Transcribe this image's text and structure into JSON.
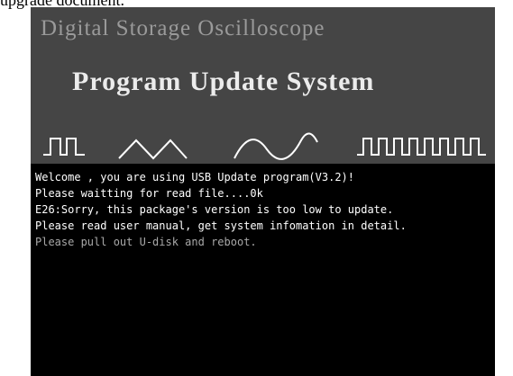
{
  "caption": "upgrade document.",
  "header": {
    "subtitle": "Digital Storage Oscilloscope",
    "title": "Program Update System"
  },
  "log": [
    {
      "text": "Welcome , you are using USB Update program(V3.2)!",
      "dim": false
    },
    {
      "text": "Please waitting for read file....0k",
      "dim": false
    },
    {
      "text": "E26:Sorry, this package's version is too low to update.",
      "dim": false
    },
    {
      "text": "Please read user manual, get system infomation in detail.",
      "dim": false
    },
    {
      "text": "Please pull out U-disk and reboot.",
      "dim": true
    }
  ],
  "colors": {
    "banner": "#454545",
    "screen": "#000000",
    "waveform": "#ffffff"
  }
}
